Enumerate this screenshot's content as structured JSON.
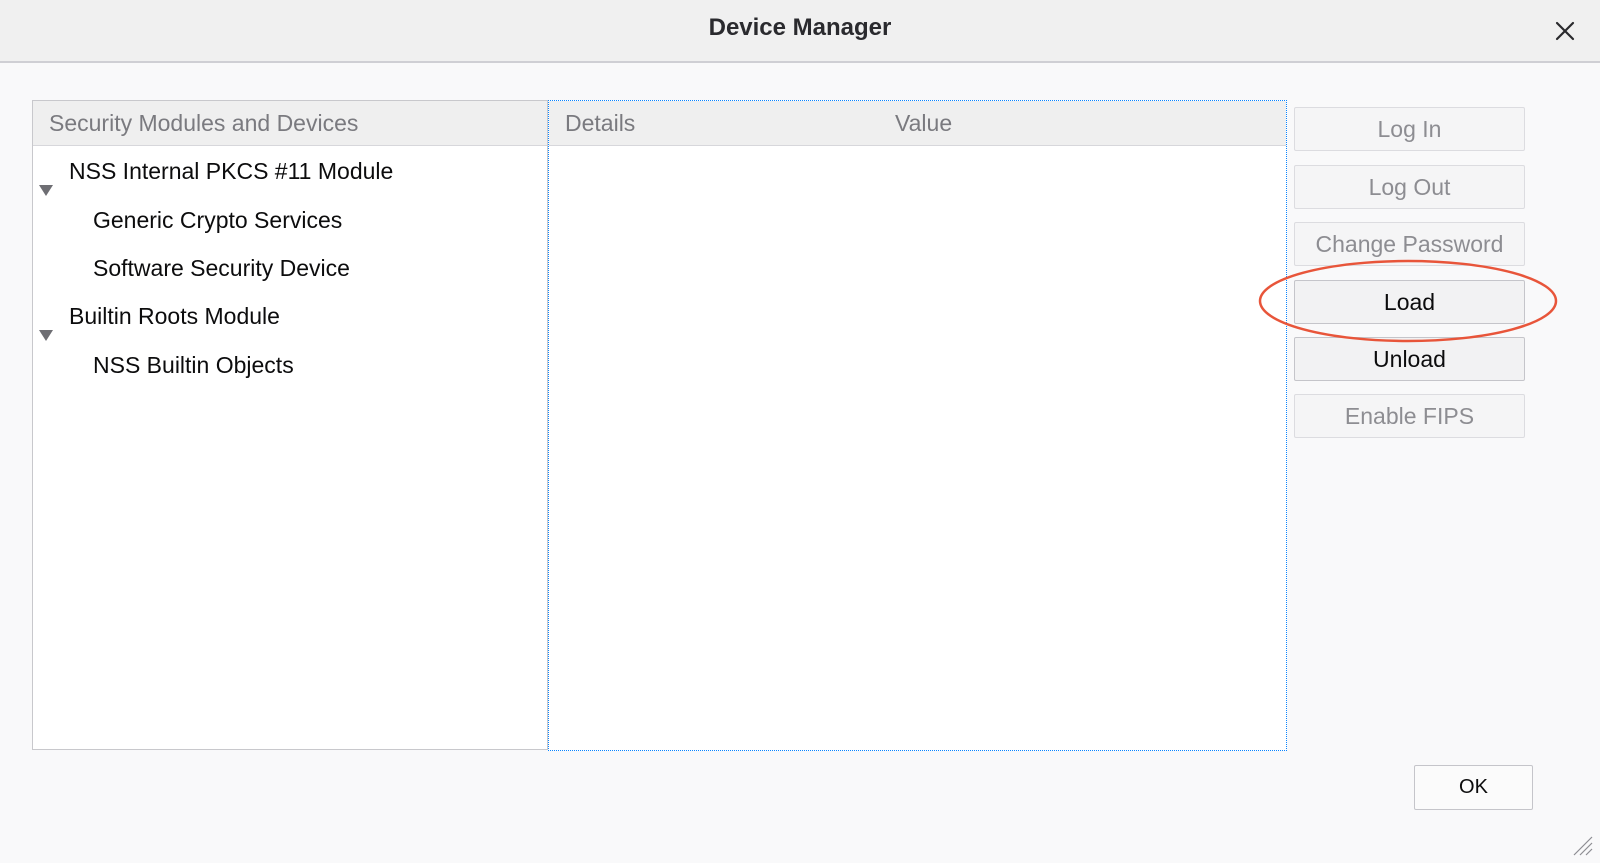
{
  "window": {
    "title": "Device Manager",
    "close_icon": "close-icon"
  },
  "tree": {
    "header": "Security Modules and Devices",
    "items": [
      {
        "label": "NSS Internal PKCS #11 Module",
        "level": 1,
        "expanded": true
      },
      {
        "label": "Generic Crypto Services",
        "level": 2
      },
      {
        "label": "Software Security Device",
        "level": 2
      },
      {
        "label": "Builtin Roots Module",
        "level": 1,
        "expanded": true
      },
      {
        "label": "NSS Builtin Objects",
        "level": 2
      }
    ]
  },
  "details": {
    "columns": [
      "Details",
      "Value"
    ]
  },
  "buttons": {
    "login": {
      "label": "Log In",
      "enabled": false
    },
    "logout": {
      "label": "Log Out",
      "enabled": false
    },
    "change_password": {
      "label": "Change Password",
      "enabled": false
    },
    "load": {
      "label": "Load",
      "enabled": true
    },
    "unload": {
      "label": "Unload",
      "enabled": true
    },
    "enable_fips": {
      "label": "Enable FIPS",
      "enabled": false
    },
    "ok": {
      "label": "OK"
    }
  },
  "colors": {
    "annotation": "#e8553a",
    "focus_border": "#0a84ff"
  }
}
